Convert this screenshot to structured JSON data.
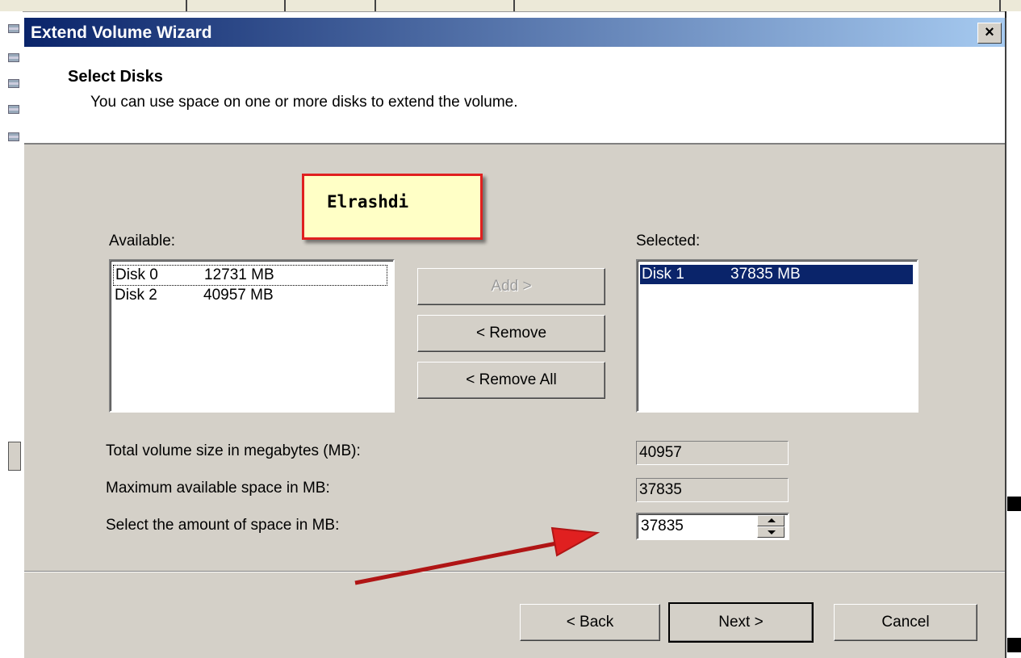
{
  "window": {
    "title": "Extend Volume Wizard",
    "close_label": "×"
  },
  "header": {
    "title": "Select Disks",
    "subtitle": "You can use space on one or more disks to extend the volume."
  },
  "callout": {
    "text": "Elrashdi"
  },
  "available": {
    "label": "Available:",
    "items": [
      {
        "disk": "Disk 0",
        "size": "12731 MB"
      },
      {
        "disk": "Disk 2",
        "size": "40957 MB"
      }
    ]
  },
  "selected": {
    "label": "Selected:",
    "items": [
      {
        "disk": "Disk 1",
        "size": "37835 MB"
      }
    ]
  },
  "buttons": {
    "add": "Add >",
    "remove": "< Remove",
    "remove_all": "< Remove All",
    "back": "< Back",
    "next": "Next >",
    "cancel": "Cancel"
  },
  "fields": {
    "total_label": "Total volume size in megabytes (MB):",
    "total_value": "40957",
    "max_label": "Maximum available space in MB:",
    "max_value": "37835",
    "amount_label": "Select the amount of space in MB:",
    "amount_value": "37835"
  },
  "colors": {
    "title_bar_start": "#0a246a",
    "title_bar_end": "#a6caf0",
    "selection": "#0a246a",
    "annotation_red": "#e02020",
    "callout_fill": "#ffffc6"
  }
}
